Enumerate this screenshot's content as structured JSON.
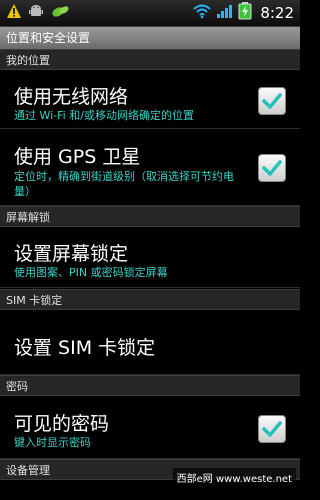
{
  "status": {
    "time": "8:22"
  },
  "title": "位置和安全设置",
  "sections": {
    "location": "我的位置",
    "screen_unlock": "屏幕解锁",
    "sim_lock": "SIM 卡锁定",
    "password": "密码",
    "device_admin": "设备管理"
  },
  "items": {
    "wireless": {
      "title": "使用无线网络",
      "subtitle": "通过 Wi-Fi 和/或移动网络确定的位置",
      "checked": true
    },
    "gps": {
      "title": "使用 GPS 卫星",
      "subtitle": "定位时，精确到街道级别（取消选择可节约电量）",
      "checked": true
    },
    "screen_lock": {
      "title": "设置屏幕锁定",
      "subtitle": "使用图案、PIN 或密码锁定屏幕"
    },
    "sim_lock": {
      "title": "设置 SIM 卡锁定"
    },
    "visible_password": {
      "title": "可见的密码",
      "subtitle": "键入时显示密码",
      "checked": true
    }
  },
  "watermark": "西部e网 www.weste.net",
  "colors": {
    "accent": "#3ad2c8",
    "check": "#22c2b8"
  }
}
